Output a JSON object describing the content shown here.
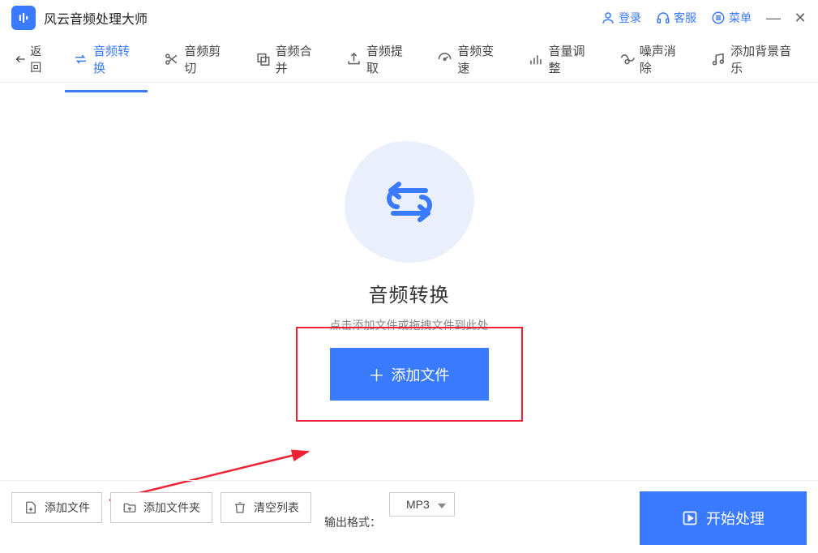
{
  "app": {
    "title": "风云音频处理大师"
  },
  "titlebar": {
    "login": "登录",
    "support": "客服",
    "menu": "菜单"
  },
  "toolbar": {
    "back": "返回",
    "items": [
      {
        "label": "音频转换"
      },
      {
        "label": "音频剪切"
      },
      {
        "label": "音频合并"
      },
      {
        "label": "音频提取"
      },
      {
        "label": "音频变速"
      },
      {
        "label": "音量调整"
      },
      {
        "label": "噪声消除"
      },
      {
        "label": "添加背景音乐"
      }
    ]
  },
  "main": {
    "title": "音频转换",
    "subtitle": "点击添加文件或拖拽文件到此处",
    "add_button": "添加文件"
  },
  "bottom": {
    "add_file": "添加文件",
    "add_folder": "添加文件夹",
    "clear_list": "清空列表",
    "output_format_label": "输出格式：",
    "output_format_value": "MP3",
    "start": "开始处理"
  }
}
